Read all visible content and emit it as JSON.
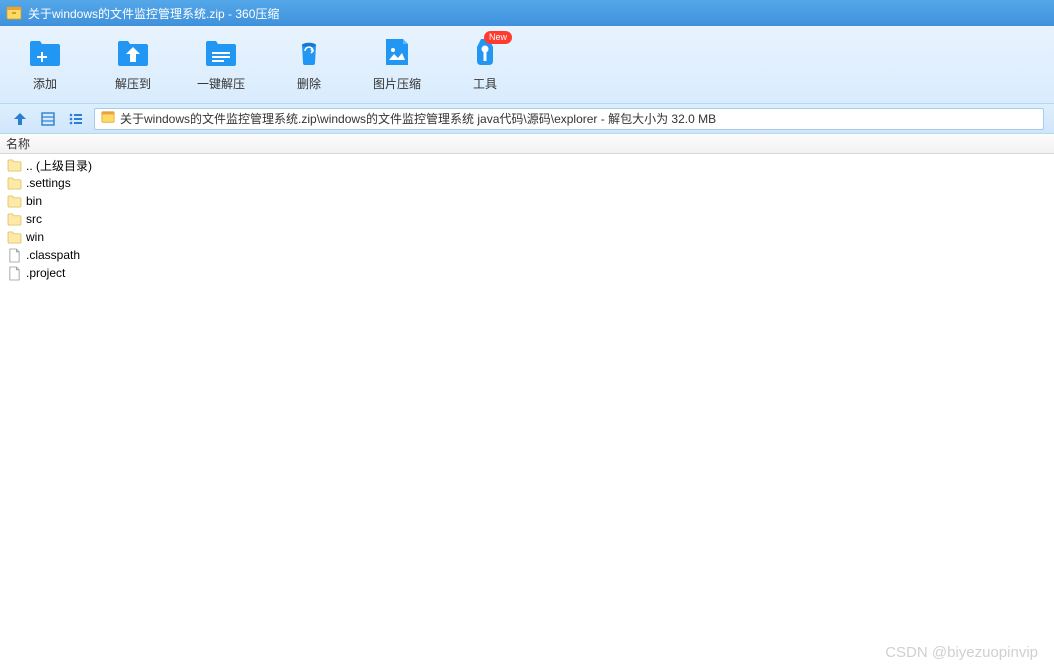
{
  "titlebar": {
    "text": "关于windows的文件监控管理系统.zip - 360压缩"
  },
  "toolbar": {
    "add": "添加",
    "extract_to": "解压到",
    "one_click_extract": "一键解压",
    "delete": "删除",
    "image_compress": "图片压缩",
    "tools": "工具",
    "badge_new": "New"
  },
  "navbar": {
    "path_text": "关于windows的文件监控管理系统.zip\\windows的文件监控管理系统 java代码\\源码\\explorer - 解包大小为 32.0 MB"
  },
  "columns": {
    "name": "名称"
  },
  "files": [
    {
      "name": ".. (上级目录)",
      "type": "folder"
    },
    {
      "name": ".settings",
      "type": "folder"
    },
    {
      "name": "bin",
      "type": "folder"
    },
    {
      "name": "src",
      "type": "folder"
    },
    {
      "name": "win",
      "type": "folder"
    },
    {
      "name": ".classpath",
      "type": "file"
    },
    {
      "name": ".project",
      "type": "file"
    }
  ],
  "watermark": "CSDN @biyezuopinvip"
}
